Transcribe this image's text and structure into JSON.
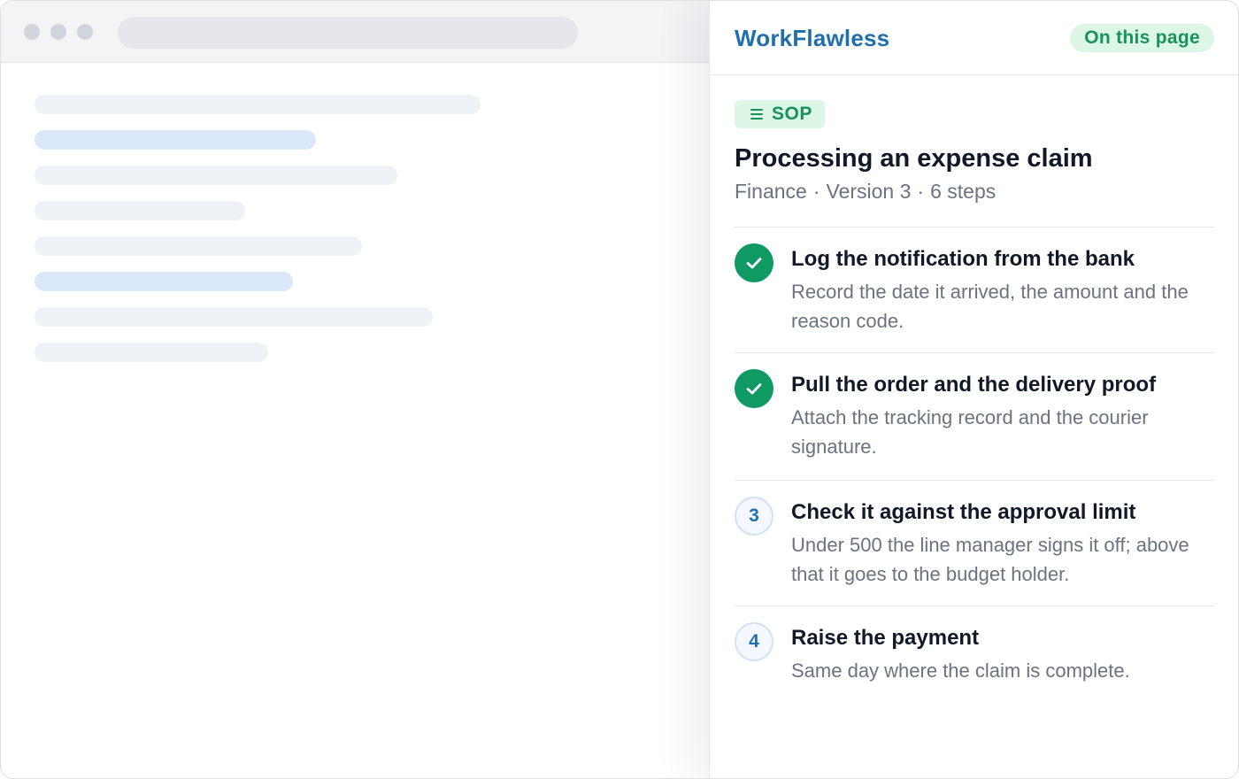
{
  "panel": {
    "brand": "WorkFlawless",
    "on_page_label": "On this page",
    "doc_type": {
      "label": "SOP",
      "icon": "list-icon"
    },
    "title": "Processing an expense claim",
    "meta": {
      "department": "Finance",
      "version": "Version 3",
      "step_count": "6 steps"
    },
    "steps": [
      {
        "status": "done",
        "marker": "check-icon",
        "title": "Log the notification from the bank",
        "description": "Record the date it arrived, the amount and the reason code."
      },
      {
        "status": "done",
        "marker": "check-icon",
        "title": "Pull the order and the delivery proof",
        "description": "Attach the tracking record and the courier signature."
      },
      {
        "status": "pending",
        "marker": "3",
        "title": "Check it against the approval limit",
        "description": "Under 500 the line manager signs it off; above that it goes to the budget holder."
      },
      {
        "status": "pending",
        "marker": "4",
        "title": "Raise the payment",
        "description": "Same day where the claim is complete."
      }
    ]
  },
  "colors": {
    "brand": "#1f6fae",
    "accent_green": "#17935a",
    "done_marker": "#0f9a63",
    "badge_bg": "#dcf7e6",
    "skeleton_blue": "#dbe8fb",
    "skeleton_grey": "#eef1f5"
  }
}
